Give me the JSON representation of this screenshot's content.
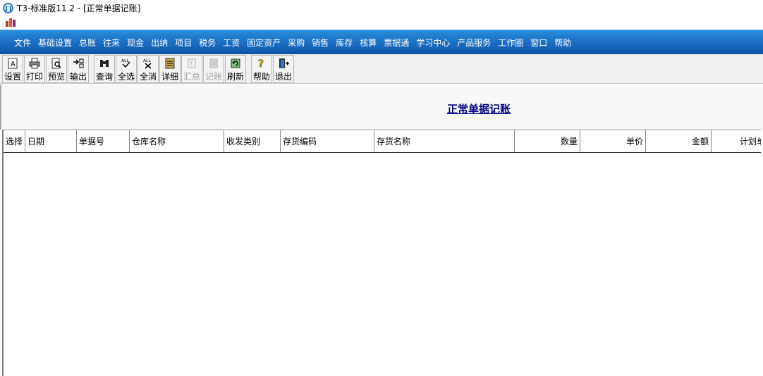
{
  "window": {
    "title": "T3-标准版11.2 - [正常单据记账]"
  },
  "menu": {
    "items": [
      "文件",
      "基础设置",
      "总账",
      "往来",
      "现金",
      "出纳",
      "项目",
      "税务",
      "工资",
      "固定资产",
      "采购",
      "销售",
      "库存",
      "核算",
      "票据通",
      "学习中心",
      "产品服务",
      "工作圈",
      "窗口",
      "帮助"
    ]
  },
  "toolbar": {
    "buttons": [
      {
        "label": "设置",
        "icon": "settings-icon",
        "enabled": true
      },
      {
        "label": "打印",
        "icon": "print-icon",
        "enabled": true
      },
      {
        "label": "预览",
        "icon": "preview-icon",
        "enabled": true
      },
      {
        "label": "输出",
        "icon": "export-icon",
        "enabled": true
      },
      {
        "label": "查询",
        "icon": "binoculars-icon",
        "enabled": true
      },
      {
        "label": "全选",
        "icon": "select-all-icon",
        "enabled": true
      },
      {
        "label": "全消",
        "icon": "deselect-all-icon",
        "enabled": true
      },
      {
        "label": "详细",
        "icon": "detail-icon",
        "enabled": true
      },
      {
        "label": "汇总",
        "icon": "summary-icon",
        "enabled": false
      },
      {
        "label": "记账",
        "icon": "posting-icon",
        "enabled": false
      },
      {
        "label": "刷新",
        "icon": "refresh-icon",
        "enabled": true
      },
      {
        "label": "帮助",
        "icon": "help-icon",
        "enabled": true
      },
      {
        "label": "退出",
        "icon": "exit-icon",
        "enabled": true
      }
    ]
  },
  "page": {
    "title": "正常单据记账"
  },
  "grid": {
    "columns": [
      "选择",
      "日期",
      "单据号",
      "仓库名称",
      "收发类别",
      "存货编码",
      "存货名称",
      "数量",
      "单价",
      "金额",
      "计划单"
    ],
    "rows": []
  },
  "colors": {
    "menu_bar": "#1b6fc4",
    "title_link": "#000080"
  }
}
